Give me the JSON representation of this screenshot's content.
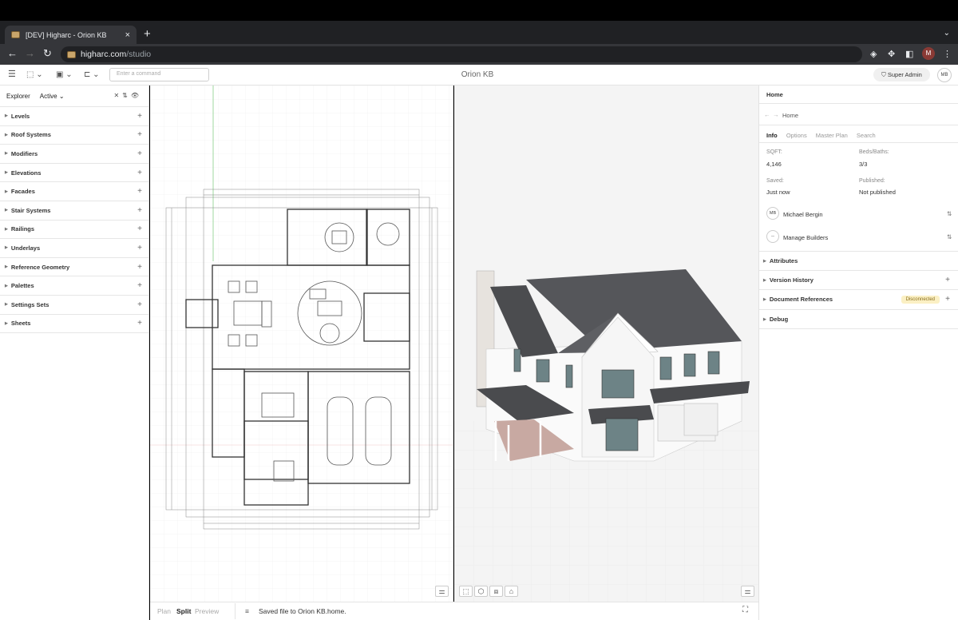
{
  "browser": {
    "tab_title": "[DEV] Higharc - Orion KB",
    "tab_close": "×",
    "new_tab": "+",
    "url_host": "higharc.com",
    "url_path": "/studio",
    "profile_initial": "M"
  },
  "toolbar": {
    "command_placeholder": "Enter a command",
    "document_title": "Orion KB",
    "role_label": "Super Admin",
    "user_initials": "MB"
  },
  "explorer": {
    "title": "Explorer",
    "filter": "Active",
    "items": [
      {
        "label": "Levels"
      },
      {
        "label": "Roof Systems"
      },
      {
        "label": "Modifiers"
      },
      {
        "label": "Elevations"
      },
      {
        "label": "Facades"
      },
      {
        "label": "Stair Systems"
      },
      {
        "label": "Railings"
      },
      {
        "label": "Underlays"
      },
      {
        "label": "Reference Geometry"
      },
      {
        "label": "Palettes"
      },
      {
        "label": "Settings Sets"
      },
      {
        "label": "Sheets"
      }
    ]
  },
  "inspector": {
    "title": "Home",
    "breadcrumb": "Home",
    "tabs": [
      "Info",
      "Options",
      "Master Plan",
      "Search"
    ],
    "sqft_label": "SQFT:",
    "sqft_value": "4,146",
    "beds_label": "Beds/Baths:",
    "beds_value": "3/3",
    "saved_label": "Saved:",
    "saved_value": "Just now",
    "published_label": "Published:",
    "published_value": "Not published",
    "owner_initials": "MB",
    "owner_name": "Michael Bergin",
    "builders_icon": "--",
    "builders_label": "Manage Builders",
    "sections": [
      {
        "label": "Attributes"
      },
      {
        "label": "Version History"
      },
      {
        "label": "Document References",
        "badge": "Disconnected"
      },
      {
        "label": "Debug"
      }
    ]
  },
  "bottom": {
    "modes": [
      "Plan",
      "Split",
      "Preview"
    ],
    "active_mode": "Split",
    "status": "Saved file to Orion KB.home."
  },
  "icons": {
    "menu": "hamburger-icon",
    "sliders": "sliders-icon",
    "cube": "cube-icon"
  }
}
